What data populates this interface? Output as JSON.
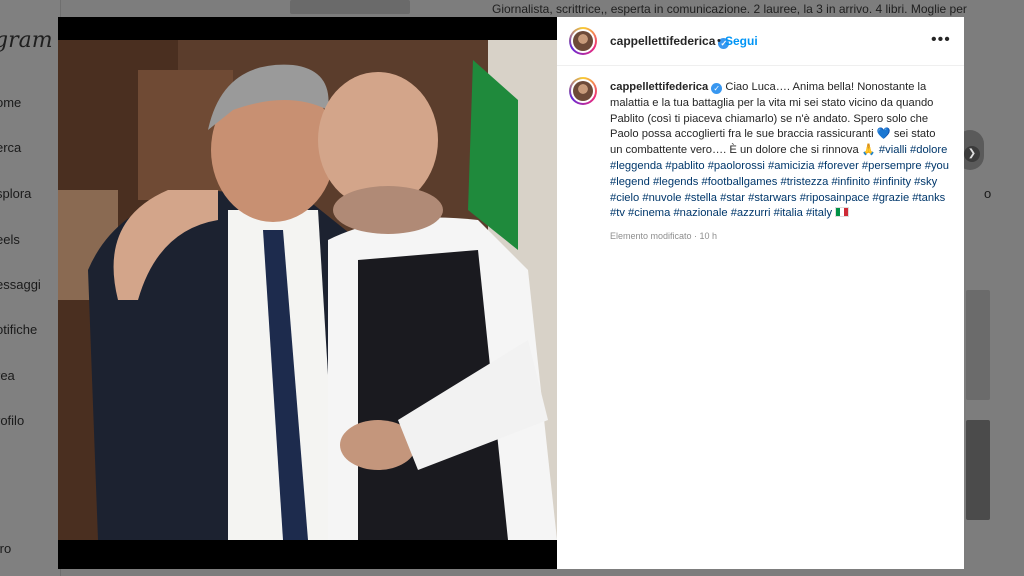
{
  "background": {
    "logo": "gram",
    "nav": [
      "ome",
      "erca",
      "splora",
      "eels",
      "essaggi",
      "otifiche",
      "rea",
      "rofilo",
      "tro"
    ],
    "bio_line": "Giornalista, scrittrice,, esperta in comunicazione. 2 lauree, la 3 in arrivo. 4 libri. Moglie per",
    "right_fragment": "o"
  },
  "post": {
    "username": "cappellettifederica",
    "follow_label": "Segui",
    "more_label": "•••",
    "caption_text": "Ciao Luca…. Anima bella! Nonostante la malattia e la tua battaglia per la vita mi sei stato vicino da quando Pablito (così ti piaceva chiamarlo) se n'è andato. Spero solo che Paolo possa accoglierti fra le sue braccia rassicuranti",
    "heart": "💙",
    "caption_text2": "sei stato un combattente vero…. È un dolore che si rinnova",
    "pray": "🙏",
    "hashtags": [
      "#vialli",
      "#dolore",
      "#leggenda",
      "#pablito",
      "#paolorossi",
      "#amicizia",
      "#forever",
      "#persempre",
      "#you",
      "#legend",
      "#legends",
      "#footballgames",
      "#tristezza",
      "#infinito",
      "#infinity",
      "#sky",
      "#cielo",
      "#nuvole",
      "#stella",
      "#star",
      "#starwars",
      "#riposainpace",
      "#grazie",
      "#tanks",
      "#tv",
      "#cinema",
      "#nazionale",
      "#azzurri",
      "#italia",
      "#italy"
    ],
    "meta": "Elemento modificato · 10 h",
    "verified_icon": "verified-badge-icon",
    "accent": "#0095f6"
  }
}
